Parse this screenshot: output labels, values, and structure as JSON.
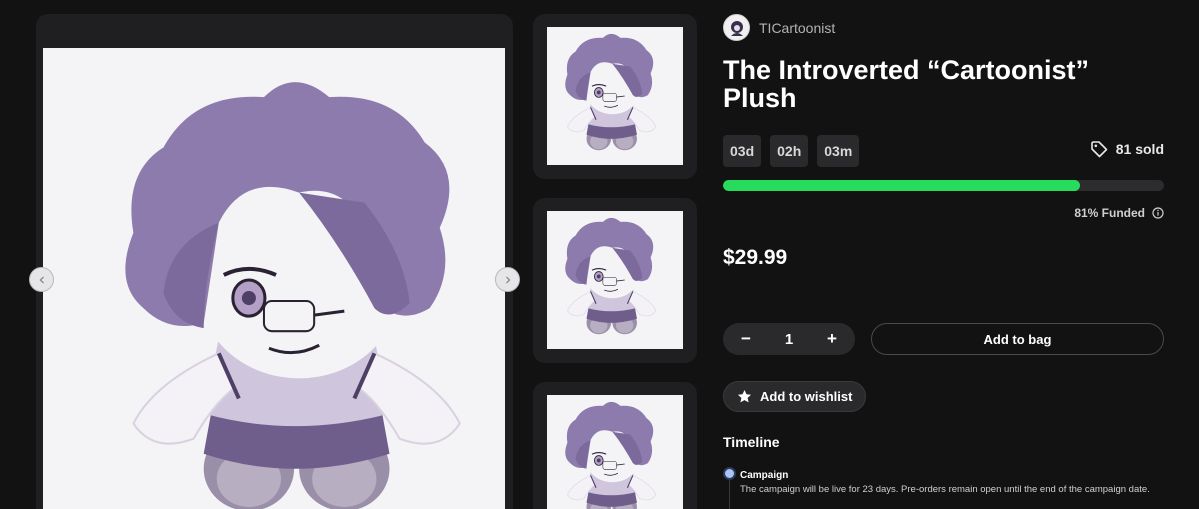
{
  "gallery": {
    "prev_icon": "chevron-left-icon",
    "next_icon": "chevron-right-icon",
    "thumbnails": [
      "plush-front-thumbnail",
      "plush-side-thumbnail",
      "plush-back-thumbnail"
    ]
  },
  "creator": {
    "name": "TICartoonist"
  },
  "product": {
    "title": "The Introverted “Cartoonist” Plush",
    "price": "$29.99"
  },
  "countdown": {
    "days": "03d",
    "hours": "02h",
    "minutes": "03m"
  },
  "sales": {
    "sold_label": "81 sold",
    "icon": "tag-icon"
  },
  "funding": {
    "percent": 81,
    "label": "81% Funded",
    "info_icon": "info-icon"
  },
  "quantity": {
    "decrement": "−",
    "value": "1",
    "increment": "+"
  },
  "actions": {
    "add_to_bag": "Add to bag",
    "wishlist": "Add to wishlist",
    "wishlist_icon": "star-icon"
  },
  "timeline": {
    "title": "Timeline",
    "steps": [
      {
        "label": "Campaign",
        "description": "The campaign will be live for 23 days. Pre-orders remain open until the end of the campaign date."
      }
    ]
  },
  "colors": {
    "background": "#121212",
    "progress": "#27dc5d",
    "card": "#1f1f21",
    "plush_purple": "#8e7bae"
  }
}
